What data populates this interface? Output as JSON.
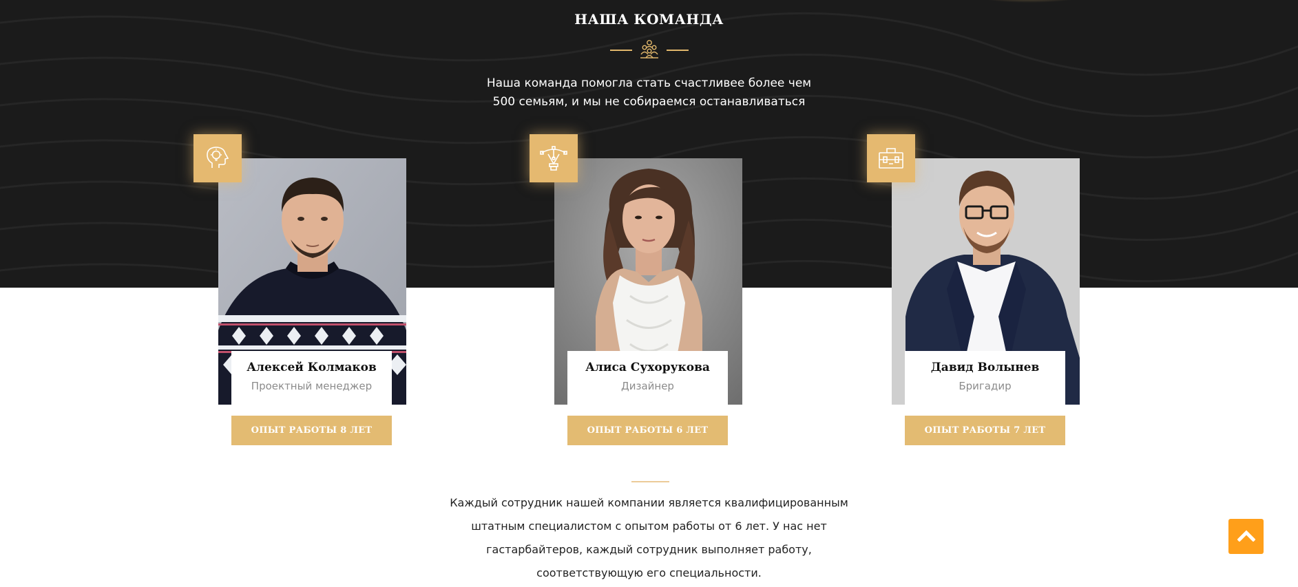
{
  "section": {
    "title": "НАША КОМАНДА",
    "subtitle_line1": "Наша команда помогла стать счастливее более чем",
    "subtitle_line2": "500 семьям, и мы не собираемся останавливаться"
  },
  "colors": {
    "accent": "#e3bb72",
    "hero_bg": "#1b1b1b",
    "scroll_button": "#ff9f1a"
  },
  "team": [
    {
      "name": "Алексей Колмаков",
      "role": "Проектный менеджер",
      "experience": "ОПЫТ РАБОТЫ 8 ЛЕТ",
      "icon": "head-lightbulb-icon"
    },
    {
      "name": "Алиса Сухорукова",
      "role": "Дизайнер",
      "experience": "ОПЫТ РАБОТЫ 6 ЛЕТ",
      "icon": "pen-tool-icon"
    },
    {
      "name": "Давид Волынев",
      "role": "Бригадир",
      "experience": "ОПЫТ РАБОТЫ 7 ЛЕТ",
      "icon": "toolbox-icon"
    }
  ],
  "footer_text": {
    "line1": "Каждый сотрудник нашей компании является квалифицированным",
    "line2": "штатным специалистом с опытом работы от 6 лет. У нас нет",
    "line3": "гастарбайтеров, каждый сотрудник выполняет работу,",
    "line4": "соответствующую его специальности."
  },
  "scroll_top_icon": "chevron-up-icon"
}
